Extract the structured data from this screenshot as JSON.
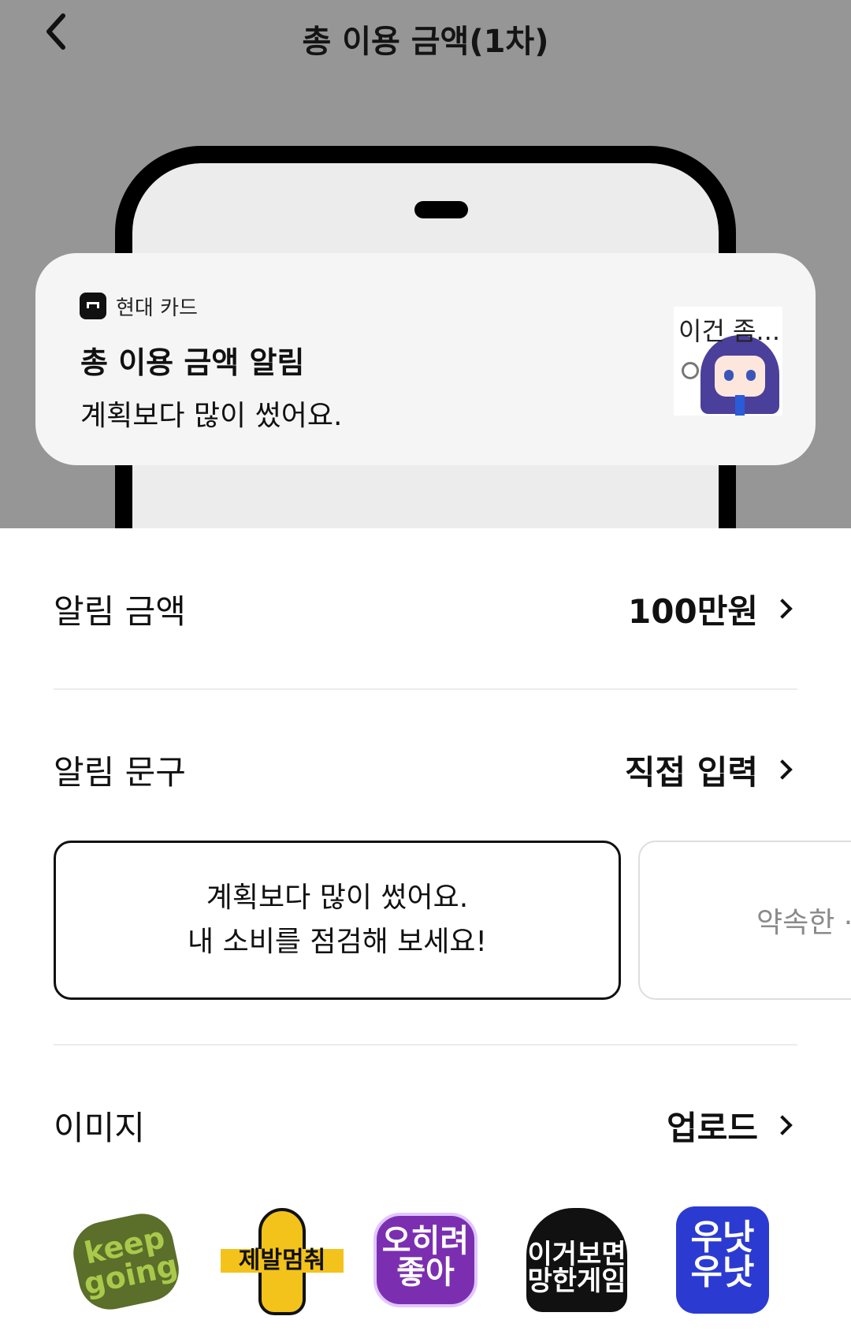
{
  "header": {
    "title": "총 이용 금액(1차)",
    "back_icon": "chevron-left-icon"
  },
  "preview": {
    "app_name": "현대 카드",
    "notification_title": "총 이용 금액 알림",
    "notification_body": "계획보다 많이 썼어요.",
    "sticker_text": "이건 좀..."
  },
  "settings": {
    "amount": {
      "label": "알림 금액",
      "value": "100만원"
    },
    "phrase": {
      "label": "알림 문구",
      "value": "직접 입력"
    },
    "image": {
      "label": "이미지",
      "value": "업로드"
    }
  },
  "phrases": [
    {
      "line1": "계획보다 많이 썼어요.",
      "line2": "내 소비를 점검해 보세요!"
    },
    {
      "line1": "약속한 ·"
    }
  ],
  "stickers": [
    {
      "name": "keep-going-sticker",
      "line1": "keep",
      "line2": "going"
    },
    {
      "name": "please-stop-sticker",
      "line1": "제발멈춰"
    },
    {
      "name": "rather-good-sticker",
      "line1": "오히려",
      "line2": "좋아"
    },
    {
      "name": "doomed-game-sticker",
      "line1": "이거보면",
      "line2": "망한게임"
    },
    {
      "name": "sulking-sticker",
      "line1": "우낫",
      "line2": "우낫"
    }
  ],
  "colors": {
    "hero_bg": "#969696",
    "sticker_green": "#7a9b3a",
    "sticker_yellow": "#f3c31c",
    "sticker_purple": "#7b2fb0",
    "sticker_black": "#111111",
    "sticker_blue": "#2b3bd1"
  }
}
